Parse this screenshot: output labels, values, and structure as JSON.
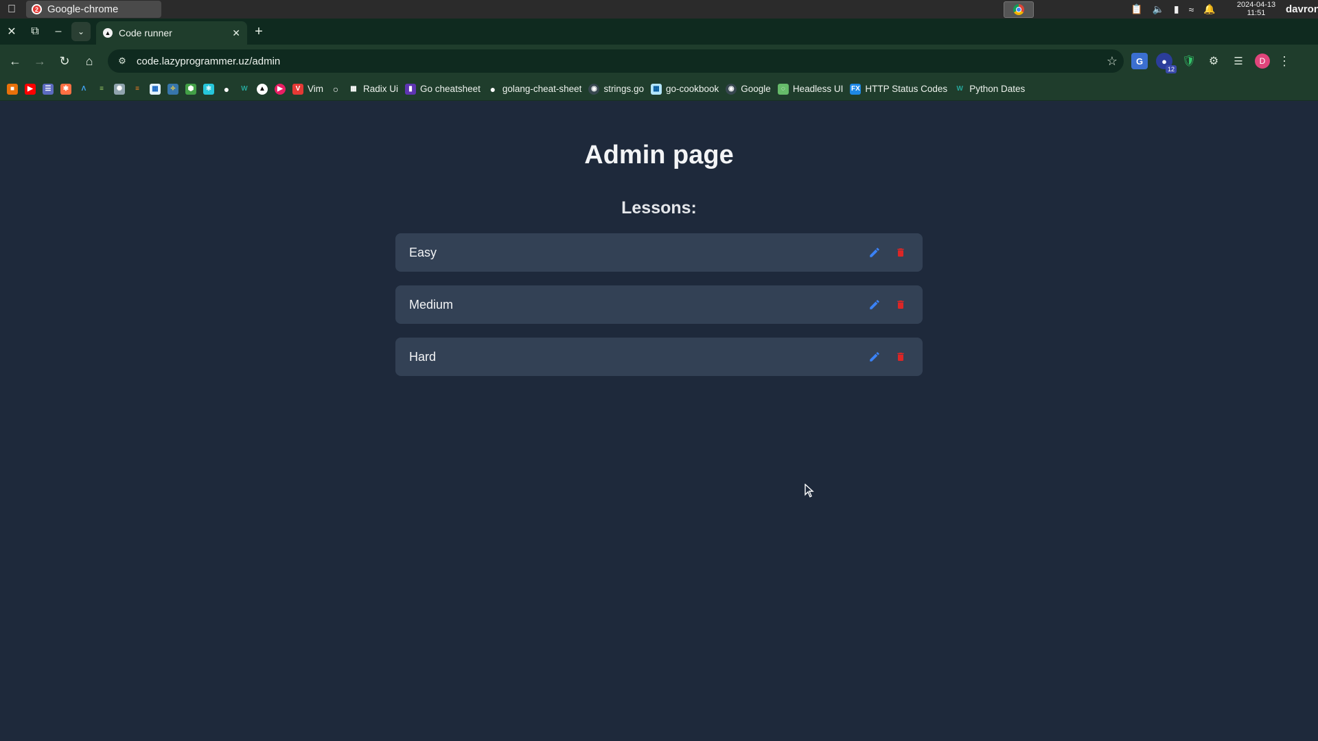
{
  "os": {
    "window_title": "Google-chrome",
    "window_badge": "2",
    "clock_date": "2024-04-13",
    "clock_time": "11:51",
    "user": "davron"
  },
  "browser": {
    "tab_title": "Code runner",
    "url": "code.lazyprogrammer.uz/admin",
    "extension_badge": "12",
    "avatar_letter": "D",
    "bookmarks": [
      {
        "label": "Vim"
      },
      {
        "label": "Radix Ui"
      },
      {
        "label": "Go cheatsheet"
      },
      {
        "label": "golang-cheat-sheet"
      },
      {
        "label": "strings.go"
      },
      {
        "label": "go-cookbook"
      },
      {
        "label": "Google"
      },
      {
        "label": "Headless UI"
      },
      {
        "label": "HTTP Status Codes"
      },
      {
        "label": "Python Dates"
      }
    ]
  },
  "page": {
    "title": "Admin page",
    "lessons_heading": "Lessons:",
    "lessons": [
      {
        "name": "Easy"
      },
      {
        "name": "Medium"
      },
      {
        "name": "Hard"
      }
    ]
  },
  "colors": {
    "page_bg": "#1e293b",
    "card_bg": "#334155",
    "edit_icon": "#3b82f6",
    "delete_icon": "#dc2626",
    "browser_frame": "#1f3d2c"
  }
}
